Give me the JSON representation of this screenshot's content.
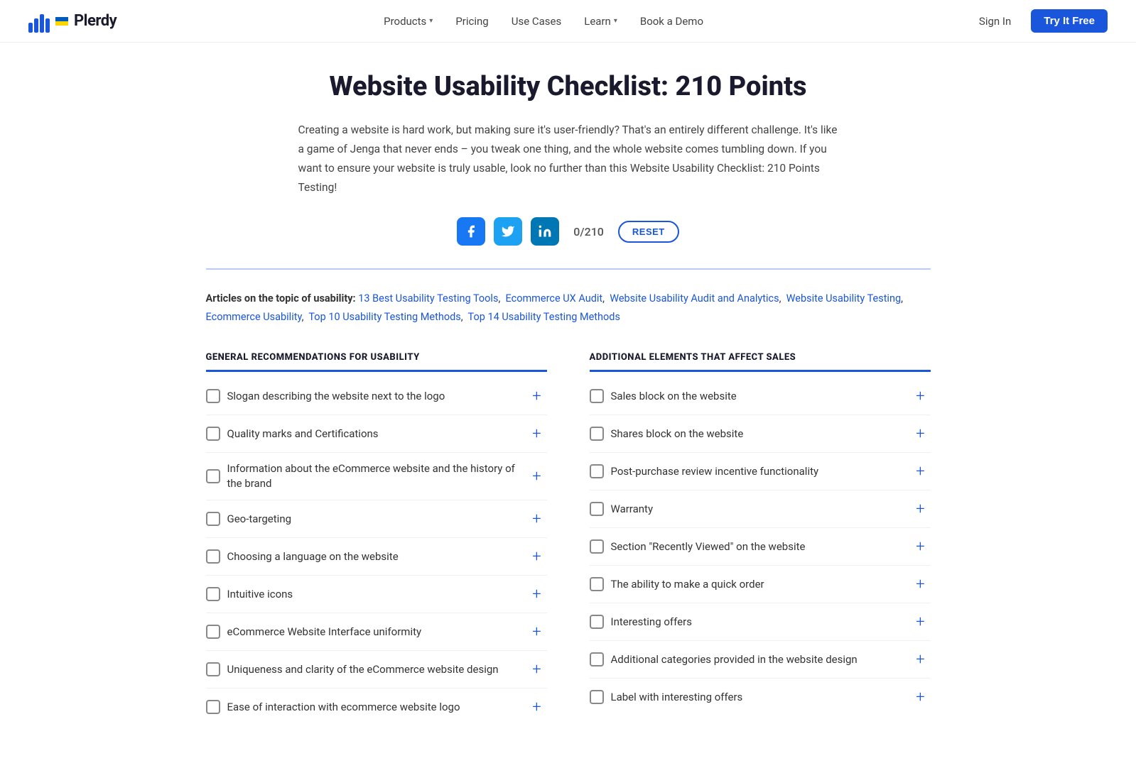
{
  "header": {
    "logo_text": "Plerdy",
    "nav": [
      {
        "label": "Products",
        "has_dropdown": true
      },
      {
        "label": "Pricing",
        "has_dropdown": false
      },
      {
        "label": "Use Cases",
        "has_dropdown": false
      },
      {
        "label": "Learn",
        "has_dropdown": true
      },
      {
        "label": "Book a Demo",
        "has_dropdown": false
      }
    ],
    "sign_in": "Sign In",
    "try_free": "Try It Free"
  },
  "hero": {
    "title": "Website Usability Checklist: 210 Points",
    "description": "Creating a website is hard work, but making sure it's user-friendly? That's an entirely different challenge. It's like a game of Jenga that never ends – you tweak one thing, and the whole website comes tumbling down. If you want to ensure your website is truly usable, look no further than this Website Usability Checklist: 210 Points Testing!",
    "counter": "0/210",
    "reset_label": "RESET"
  },
  "articles": {
    "prefix": "Articles on the topic of usability:",
    "links": [
      "13 Best Usability Testing Tools",
      "Ecommerce UX Audit",
      "Website Usability Audit and Analytics",
      "Website Usability Testing",
      "Ecommerce Usability",
      "Top 10 Usability Testing Methods",
      "Top 14 Usability Testing Methods"
    ]
  },
  "left_section": {
    "title": "GENERAL RECOMMENDATIONS FOR USABILITY",
    "items": [
      "Slogan describing the website next to the logo",
      "Quality marks and Certifications",
      "Information about the eCommerce website and the history of the brand",
      "Geo-targeting",
      "Choosing a language on the website",
      "Intuitive icons",
      "eCommerce Website Interface uniformity",
      "Uniqueness and clarity of the eCommerce website design",
      "Ease of interaction with ecommerce website logo"
    ]
  },
  "right_section": {
    "title": "ADDITIONAL ELEMENTS THAT AFFECT SALES",
    "items": [
      "Sales block on the website",
      "Shares block on the website",
      "Post-purchase review incentive functionality",
      "Warranty",
      "Section “Recently Viewed” on the website",
      "The ability to make a quick order",
      "Interesting offers",
      "Additional categories provided in the website design",
      "Label with interesting offers"
    ]
  }
}
